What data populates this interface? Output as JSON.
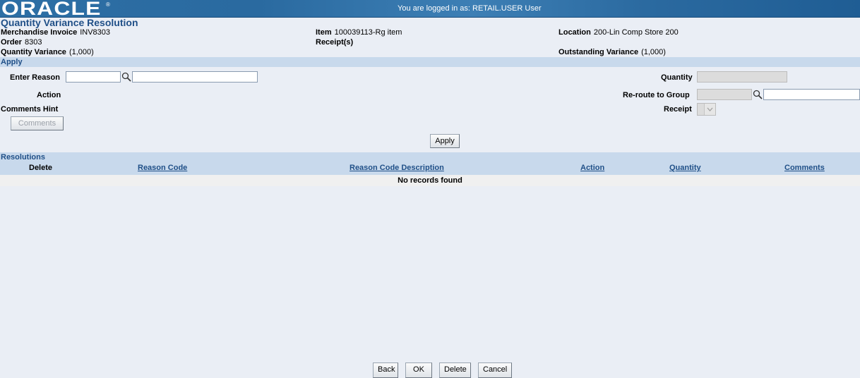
{
  "header": {
    "logo_text": "ORACLE",
    "logo_mark": "®",
    "login_message": "You are logged in as: RETAIL.USER User"
  },
  "page": {
    "title": "Quantity Variance Resolution"
  },
  "info": {
    "merch_invoice_label": "Merchandise Invoice",
    "merch_invoice_value": "INV8303",
    "order_label": "Order",
    "order_value": "8303",
    "qty_variance_label": "Quantity Variance",
    "qty_variance_value": "(1,000)",
    "item_label": "Item",
    "item_value": "100039113-Rg item",
    "receipts_label": "Receipt(s)",
    "location_label": "Location",
    "location_value": "200-Lin Comp Store 200",
    "outstanding_label": "Outstanding Variance",
    "outstanding_value": "(1,000)"
  },
  "apply_section": {
    "header": "Apply",
    "enter_reason_label": "Enter Reason",
    "enter_reason_code": "",
    "enter_reason_desc": "",
    "action_label": "Action",
    "comments_hint_label": "Comments Hint",
    "comments_button": "Comments",
    "quantity_label": "Quantity",
    "quantity_value": "",
    "reroute_label": "Re-route to Group",
    "reroute_value": "",
    "reroute_desc": "",
    "receipt_label": "Receipt",
    "receipt_value": "",
    "apply_button": "Apply"
  },
  "resolutions": {
    "header": "Resolutions",
    "columns": [
      "Delete",
      "Reason Code",
      "Reason Code Description",
      "Action",
      "Quantity",
      "Comments"
    ],
    "empty_message": "No records found"
  },
  "footer": {
    "back": "Back",
    "ok": "OK",
    "delete": "Delete",
    "cancel": "Cancel"
  },
  "colors": {
    "accent": "#1f4f87",
    "section_bg": "#c8d9ec",
    "page_bg": "#eaeef5",
    "topbar": "#2d6fa5"
  }
}
